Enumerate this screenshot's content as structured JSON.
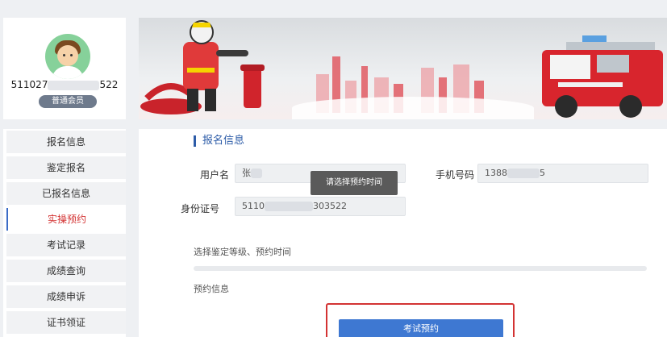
{
  "profile": {
    "id_prefix": "511027",
    "id_suffix": "522",
    "member_badge": "普通会员"
  },
  "sidebar": {
    "items": [
      {
        "label": "报名信息"
      },
      {
        "label": "鉴定报名"
      },
      {
        "label": "已报名信息"
      },
      {
        "label": "实操预约",
        "active": true
      },
      {
        "label": "考试记录"
      },
      {
        "label": "成绩查询"
      },
      {
        "label": "成绩申诉"
      },
      {
        "label": "证书领证"
      }
    ]
  },
  "main": {
    "section_title": "报名信息",
    "username_label": "用户名",
    "username_value": "张",
    "phone_label": "手机号码",
    "phone_prefix": "1388",
    "phone_suffix": "5",
    "idcard_label": "身份证号",
    "idcard_prefix": "5110",
    "idcard_suffix": "303522",
    "tooltip": "请选择预约时间",
    "hint": "选择鉴定等级、预约时间",
    "booking_info_label": "预约信息",
    "book_button": "考试预约"
  },
  "colors": {
    "accent_blue": "#2d5ca8",
    "button_blue": "#3e78d2",
    "active_red": "#d33333"
  }
}
